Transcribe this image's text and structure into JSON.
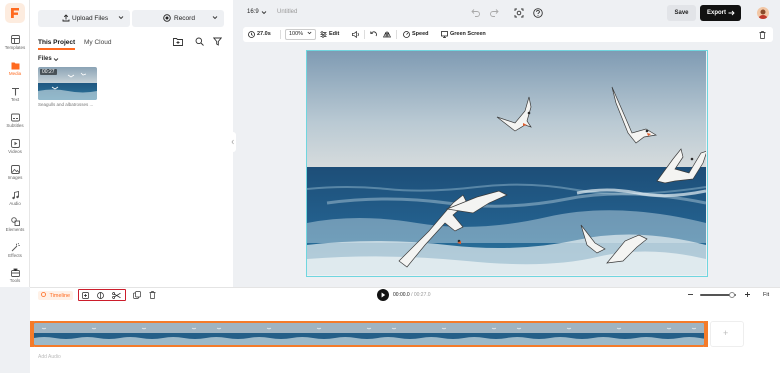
{
  "rail": {
    "items": [
      {
        "label": "Templates",
        "icon": "templates-icon"
      },
      {
        "label": "Media",
        "icon": "media-icon",
        "active": true
      },
      {
        "label": "Text",
        "icon": "text-icon"
      },
      {
        "label": "Subtitles",
        "icon": "subtitles-icon"
      },
      {
        "label": "Videos",
        "icon": "videos-icon"
      },
      {
        "label": "Images",
        "icon": "images-icon"
      },
      {
        "label": "Audio",
        "icon": "audio-icon"
      },
      {
        "label": "Elements",
        "icon": "elements-icon"
      },
      {
        "label": "Effects",
        "icon": "effects-icon"
      },
      {
        "label": "Tools",
        "icon": "tools-icon"
      }
    ]
  },
  "panel": {
    "upload_label": "Upload Files",
    "record_label": "Record",
    "tabs": [
      "This Project",
      "My Cloud"
    ],
    "files_heading": "Files",
    "media": [
      {
        "duration": "00:27",
        "name": "Seagulls and albatrosses ..."
      }
    ]
  },
  "topbar": {
    "aspect_ratio": "16:9",
    "title": "Untitled",
    "save_label": "Save",
    "export_label": "Export"
  },
  "edit_bar": {
    "duration": "27.0s",
    "zoom": "100%",
    "edit_label": "Edit",
    "speed_label": "Speed",
    "green_screen_label": "Green Screen"
  },
  "timeline": {
    "label": "Timeline",
    "current_time": "00:00.0",
    "total_time": "/ 00:27.0",
    "fit_label": "Fit",
    "audio_placeholder": "Add Audio"
  },
  "colors": {
    "accent": "#ff6a1f",
    "clip_border": "#f47b2a",
    "selection_frame": "#6fd6df",
    "highlight_box": "#cc1d2b"
  }
}
